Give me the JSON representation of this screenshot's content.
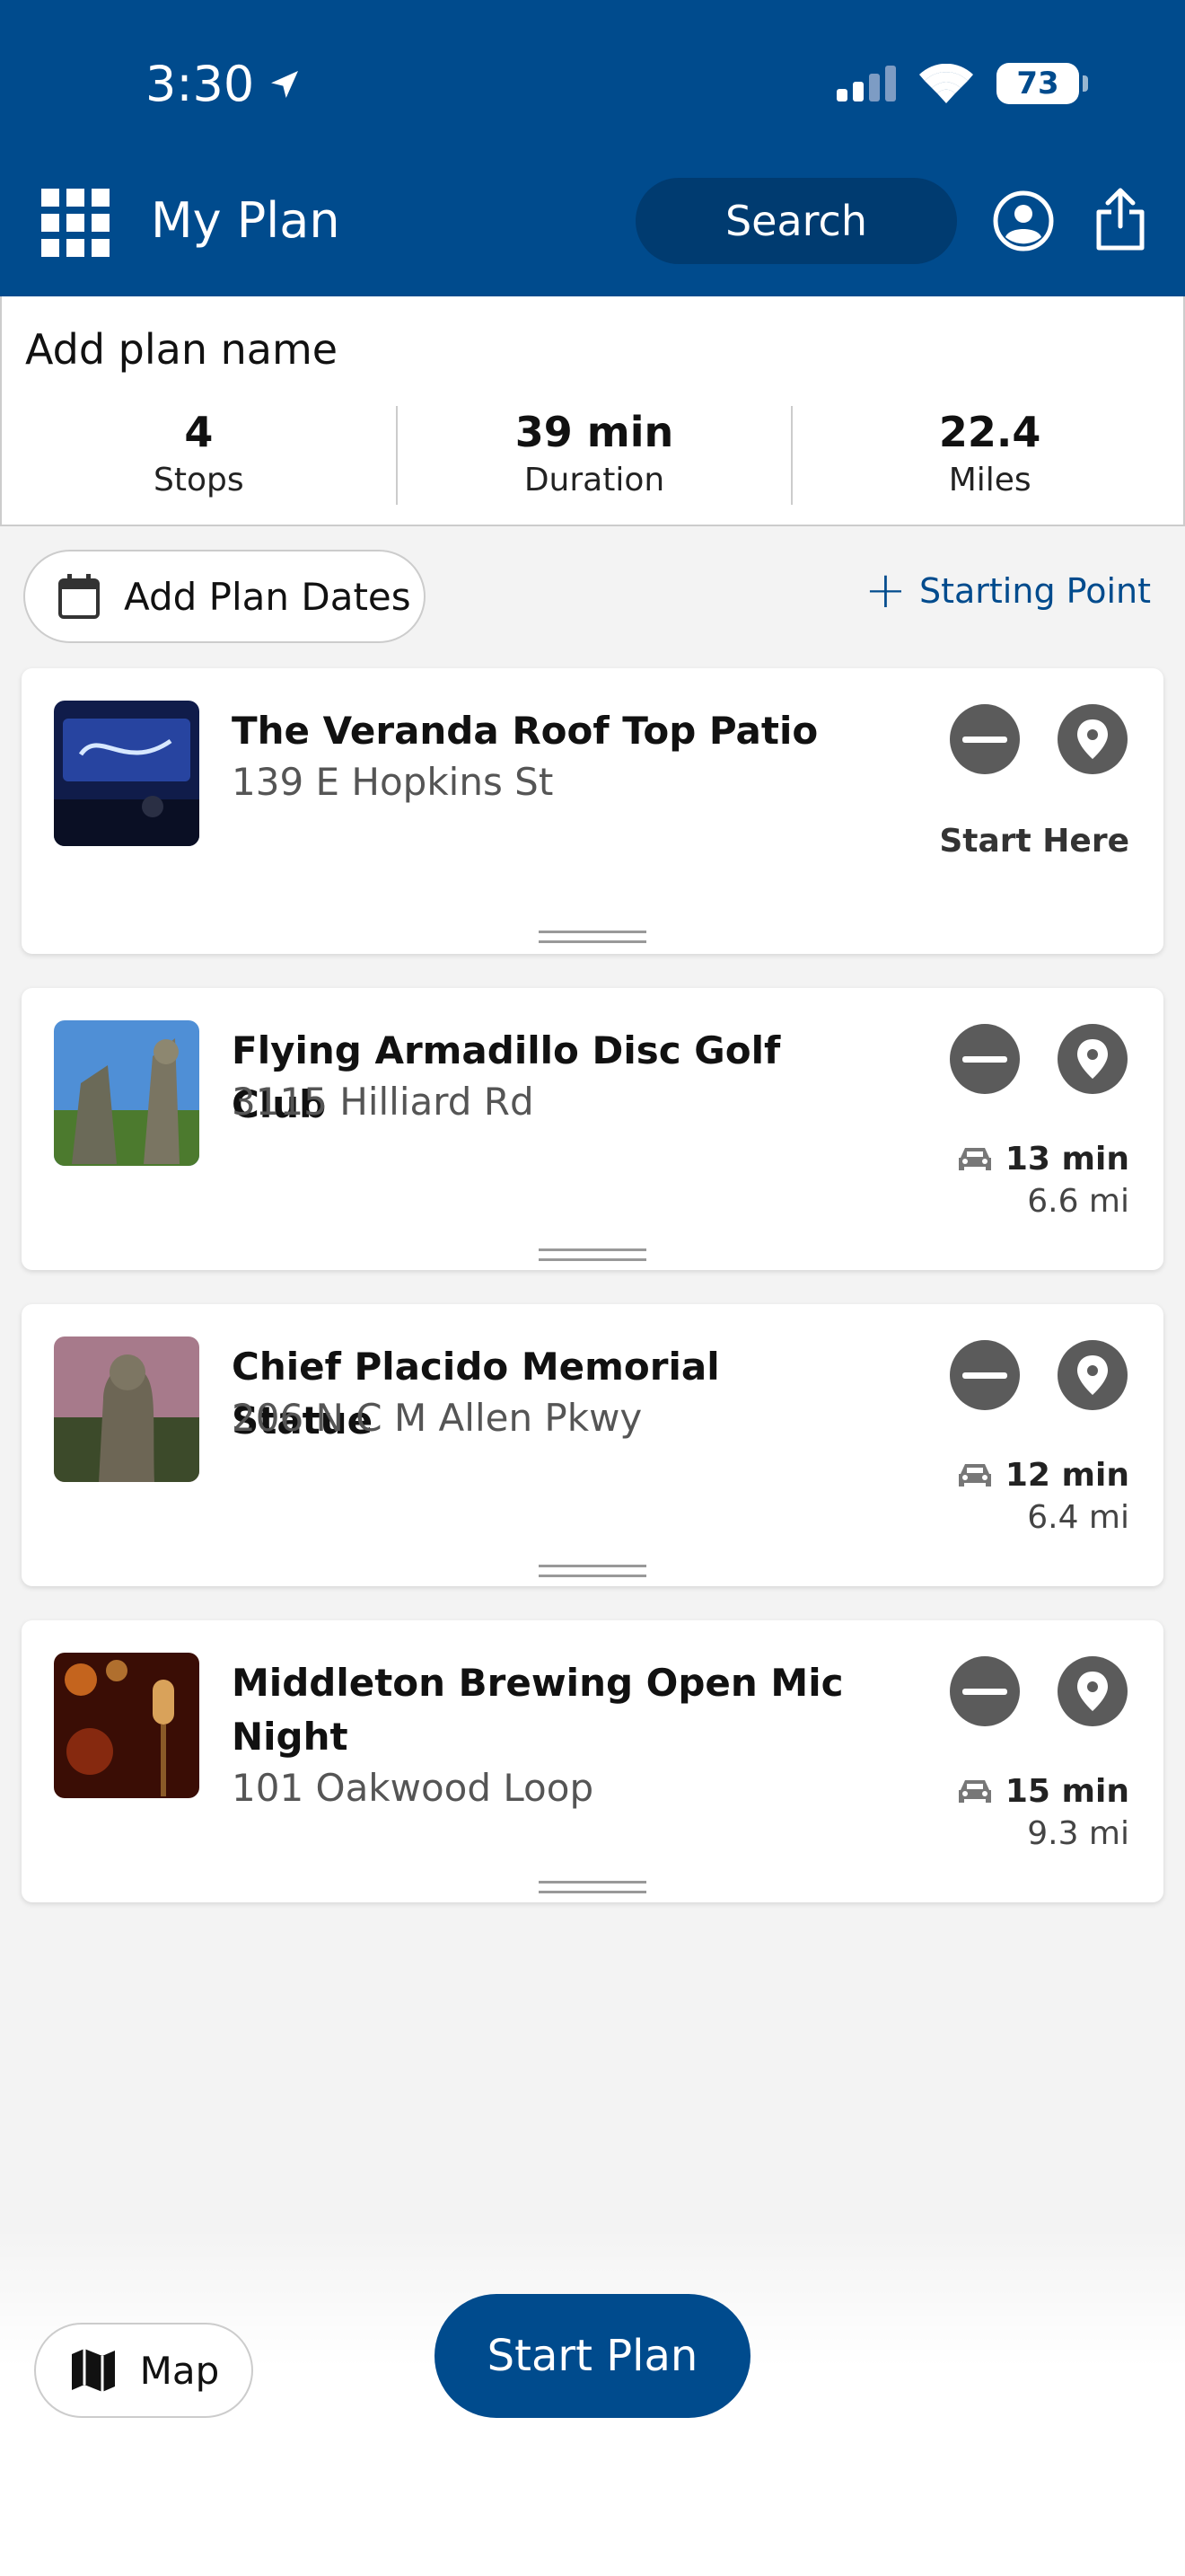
{
  "status_bar": {
    "time": "3:30",
    "battery": "73"
  },
  "header": {
    "title": "My Plan",
    "search_label": "Search"
  },
  "summary": {
    "plan_name_placeholder": "Add plan name",
    "stats": [
      {
        "value": "4",
        "label": "Stops"
      },
      {
        "value": "39 min",
        "label": "Duration"
      },
      {
        "value": "22.4",
        "label": "Miles"
      }
    ]
  },
  "controls": {
    "dates_label": "Add Plan Dates",
    "starting_point_label": "Starting Point"
  },
  "stops": [
    {
      "name": "The Veranda Roof Top Patio",
      "address": "139 E Hopkins St",
      "start_label": "Start Here"
    },
    {
      "name": "Flying Armadillo Disc Golf Club",
      "address": "3115 Hilliard Rd",
      "drive_time": "13 min",
      "distance": "6.6 mi"
    },
    {
      "name": "Chief Placido Memorial Statue",
      "address": "206 N C M Allen Pkwy",
      "drive_time": "12 min",
      "distance": "6.4 mi"
    },
    {
      "name": "Middleton Brewing Open Mic Night",
      "address": "101 Oakwood Loop",
      "drive_time": "15 min",
      "distance": "9.3 mi"
    }
  ],
  "bottom": {
    "map_label": "Map",
    "start_plan_label": "Start Plan"
  },
  "colors": {
    "primary": "#004b8d",
    "icon_gray": "#5b5b5b"
  }
}
